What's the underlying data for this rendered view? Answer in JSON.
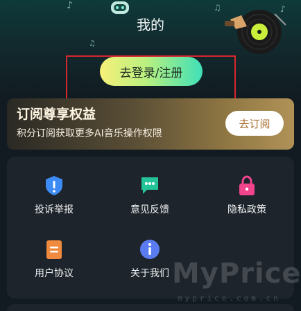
{
  "header": {
    "title": "我的",
    "login_label": "去登录/注册"
  },
  "vip": {
    "title": "订阅尊享权益",
    "subtitle": "积分订阅获取更多AI音乐操作权限",
    "subscribe_label": "去订阅"
  },
  "menu": {
    "items": [
      {
        "label": "投诉举报",
        "icon": "shield-exclamation-icon",
        "color": "#3d8cf5"
      },
      {
        "label": "意见反馈",
        "icon": "chat-bubble-icon",
        "color": "#24c39a"
      },
      {
        "label": "隐私政策",
        "icon": "lock-icon",
        "color": "#f0448c"
      },
      {
        "label": "用户协议",
        "icon": "document-icon",
        "color": "#f08a3e"
      },
      {
        "label": "关于我们",
        "icon": "info-icon",
        "color": "#5a7cf0"
      }
    ]
  },
  "watermark": {
    "big": "MyPrice",
    "small": "myprice.com.cn"
  },
  "colors": {
    "background": "#121a22",
    "card": "#1e242b",
    "highlight": "#d7262e"
  }
}
